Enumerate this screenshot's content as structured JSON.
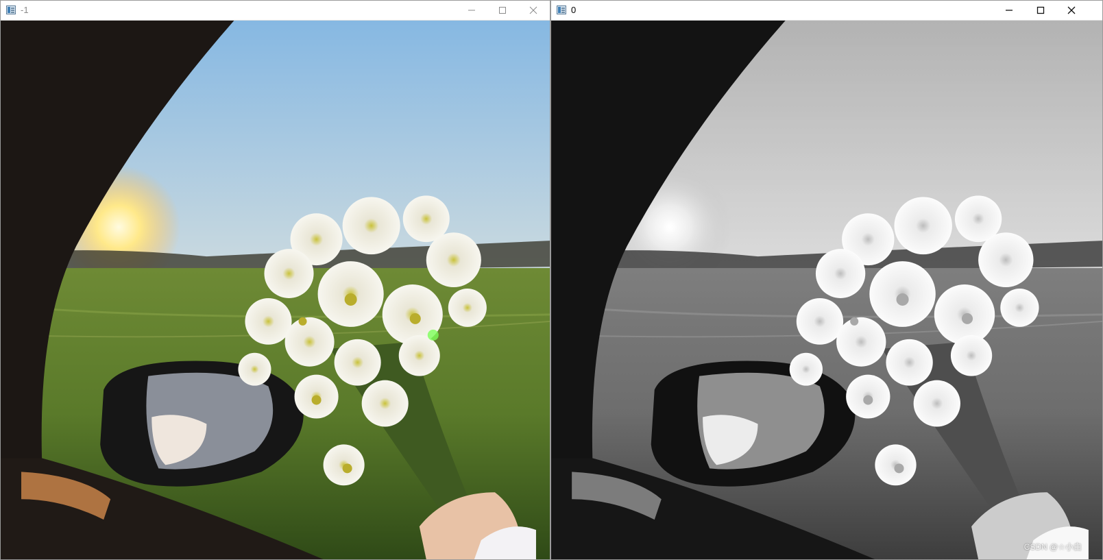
{
  "windows": [
    {
      "id": "left",
      "title": "-1",
      "active": false,
      "mode": "color"
    },
    {
      "id": "right",
      "title": "0",
      "active": true,
      "mode": "grayscale"
    }
  ],
  "icons": {
    "app": "opencv-window-icon",
    "minimize": "minimize-icon",
    "maximize": "maximize-icon",
    "close": "close-icon"
  },
  "watermark": "CSDN @☆小白",
  "colors": {
    "titlebar_bg": "#ffffff",
    "title_inactive": "#8a8a8a",
    "title_active": "#000000",
    "sky_top": "#7fb3e0",
    "sun": "#fff2b0",
    "grass": "#5d7a2a",
    "car_frame": "#1a1614"
  }
}
